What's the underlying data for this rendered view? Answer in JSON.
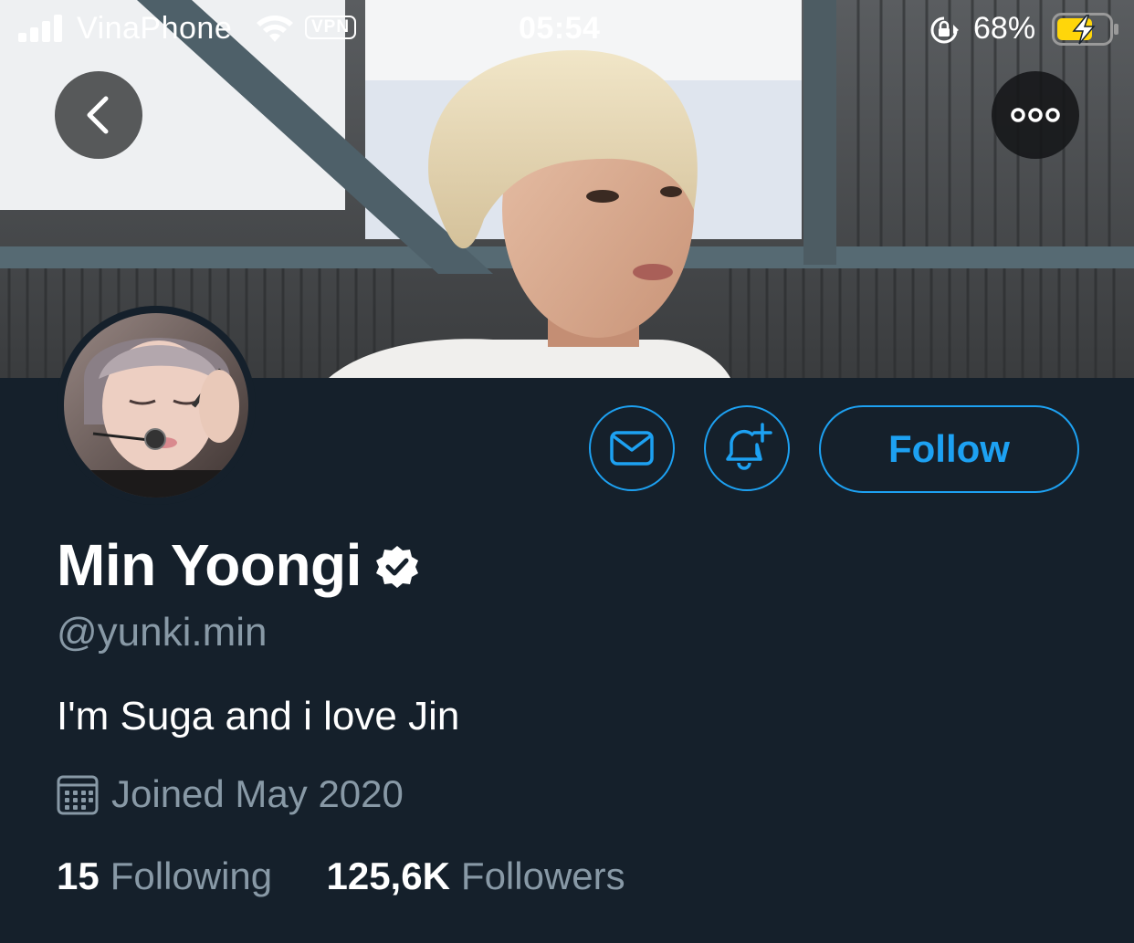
{
  "status_bar": {
    "carrier": "VinaPhone",
    "vpn": "VPN",
    "time": "05:54",
    "battery_percent": "68%",
    "icons": [
      "signal-icon",
      "wifi-icon",
      "orientation-lock-icon",
      "battery-charging-icon"
    ]
  },
  "header": {
    "back_icon": "chevron-left-icon",
    "more_icon": "more-horizontal-icon"
  },
  "actions": {
    "message_icon": "envelope-icon",
    "notify_icon": "bell-plus-icon",
    "follow_label": "Follow"
  },
  "profile": {
    "name": "Min Yoongi",
    "verified": true,
    "handle": "@yunki.min",
    "bio": "I'm Suga and i love Jin",
    "joined": "Joined May 2020",
    "following_count": "15",
    "following_label": "Following",
    "followers_count": "125,6K",
    "followers_label": "Followers"
  },
  "colors": {
    "background": "#15202b",
    "accent": "#1da1f2",
    "secondary_text": "#8899a6",
    "primary_text": "#ffffff",
    "battery_fill": "#ffd60a"
  }
}
